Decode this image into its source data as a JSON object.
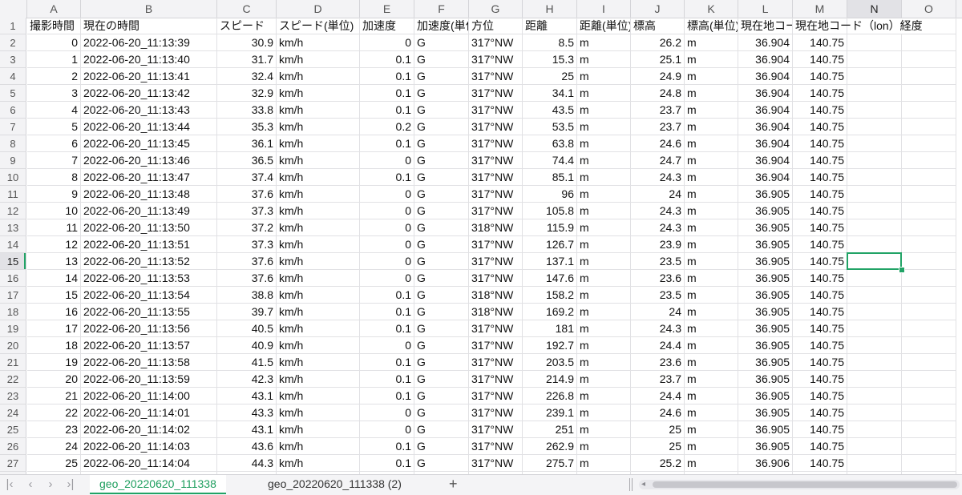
{
  "columns": [
    "A",
    "B",
    "C",
    "D",
    "E",
    "F",
    "G",
    "H",
    "I",
    "J",
    "K",
    "L",
    "M",
    "N",
    "O"
  ],
  "selected_column": "N",
  "selected_row": 15,
  "header_row": {
    "A": "撮影時間",
    "B": "現在の時間",
    "C": "スピード",
    "D": "スピード(単位)",
    "E": "加速度",
    "F": "加速度(単位)",
    "G": "方位",
    "H": "距離",
    "I": "距離(単位)",
    "J": "標高",
    "K": "標高(単位)",
    "L": "現在地コード（lat）",
    "M": "現在地コード（lon）経度"
  },
  "rows": [
    [
      "0",
      "2022-06-20_11:13:39",
      "30.9",
      "km/h",
      "0",
      "G",
      "317°NW",
      "8.5",
      "m",
      "26.2",
      "m",
      "36.904",
      "140.75"
    ],
    [
      "1",
      "2022-06-20_11:13:40",
      "31.7",
      "km/h",
      "0.1",
      "G",
      "317°NW",
      "15.3",
      "m",
      "25.1",
      "m",
      "36.904",
      "140.75"
    ],
    [
      "2",
      "2022-06-20_11:13:41",
      "32.4",
      "km/h",
      "0.1",
      "G",
      "317°NW",
      "25",
      "m",
      "24.9",
      "m",
      "36.904",
      "140.75"
    ],
    [
      "3",
      "2022-06-20_11:13:42",
      "32.9",
      "km/h",
      "0.1",
      "G",
      "317°NW",
      "34.1",
      "m",
      "24.8",
      "m",
      "36.904",
      "140.75"
    ],
    [
      "4",
      "2022-06-20_11:13:43",
      "33.8",
      "km/h",
      "0.1",
      "G",
      "317°NW",
      "43.5",
      "m",
      "23.7",
      "m",
      "36.904",
      "140.75"
    ],
    [
      "5",
      "2022-06-20_11:13:44",
      "35.3",
      "km/h",
      "0.2",
      "G",
      "317°NW",
      "53.5",
      "m",
      "23.7",
      "m",
      "36.904",
      "140.75"
    ],
    [
      "6",
      "2022-06-20_11:13:45",
      "36.1",
      "km/h",
      "0.1",
      "G",
      "317°NW",
      "63.8",
      "m",
      "24.6",
      "m",
      "36.904",
      "140.75"
    ],
    [
      "7",
      "2022-06-20_11:13:46",
      "36.5",
      "km/h",
      "0",
      "G",
      "317°NW",
      "74.4",
      "m",
      "24.7",
      "m",
      "36.904",
      "140.75"
    ],
    [
      "8",
      "2022-06-20_11:13:47",
      "37.4",
      "km/h",
      "0.1",
      "G",
      "317°NW",
      "85.1",
      "m",
      "24.3",
      "m",
      "36.904",
      "140.75"
    ],
    [
      "9",
      "2022-06-20_11:13:48",
      "37.6",
      "km/h",
      "0",
      "G",
      "317°NW",
      "96",
      "m",
      "24",
      "m",
      "36.905",
      "140.75"
    ],
    [
      "10",
      "2022-06-20_11:13:49",
      "37.3",
      "km/h",
      "0",
      "G",
      "317°NW",
      "105.8",
      "m",
      "24.3",
      "m",
      "36.905",
      "140.75"
    ],
    [
      "11",
      "2022-06-20_11:13:50",
      "37.2",
      "km/h",
      "0",
      "G",
      "318°NW",
      "115.9",
      "m",
      "24.3",
      "m",
      "36.905",
      "140.75"
    ],
    [
      "12",
      "2022-06-20_11:13:51",
      "37.3",
      "km/h",
      "0",
      "G",
      "317°NW",
      "126.7",
      "m",
      "23.9",
      "m",
      "36.905",
      "140.75"
    ],
    [
      "13",
      "2022-06-20_11:13:52",
      "37.6",
      "km/h",
      "0",
      "G",
      "317°NW",
      "137.1",
      "m",
      "23.5",
      "m",
      "36.905",
      "140.75"
    ],
    [
      "14",
      "2022-06-20_11:13:53",
      "37.6",
      "km/h",
      "0",
      "G",
      "317°NW",
      "147.6",
      "m",
      "23.6",
      "m",
      "36.905",
      "140.75"
    ],
    [
      "15",
      "2022-06-20_11:13:54",
      "38.8",
      "km/h",
      "0.1",
      "G",
      "318°NW",
      "158.2",
      "m",
      "23.5",
      "m",
      "36.905",
      "140.75"
    ],
    [
      "16",
      "2022-06-20_11:13:55",
      "39.7",
      "km/h",
      "0.1",
      "G",
      "318°NW",
      "169.2",
      "m",
      "24",
      "m",
      "36.905",
      "140.75"
    ],
    [
      "17",
      "2022-06-20_11:13:56",
      "40.5",
      "km/h",
      "0.1",
      "G",
      "317°NW",
      "181",
      "m",
      "24.3",
      "m",
      "36.905",
      "140.75"
    ],
    [
      "18",
      "2022-06-20_11:13:57",
      "40.9",
      "km/h",
      "0",
      "G",
      "317°NW",
      "192.7",
      "m",
      "24.4",
      "m",
      "36.905",
      "140.75"
    ],
    [
      "19",
      "2022-06-20_11:13:58",
      "41.5",
      "km/h",
      "0.1",
      "G",
      "317°NW",
      "203.5",
      "m",
      "23.6",
      "m",
      "36.905",
      "140.75"
    ],
    [
      "20",
      "2022-06-20_11:13:59",
      "42.3",
      "km/h",
      "0.1",
      "G",
      "317°NW",
      "214.9",
      "m",
      "23.7",
      "m",
      "36.905",
      "140.75"
    ],
    [
      "21",
      "2022-06-20_11:14:00",
      "43.1",
      "km/h",
      "0.1",
      "G",
      "317°NW",
      "226.8",
      "m",
      "24.4",
      "m",
      "36.905",
      "140.75"
    ],
    [
      "22",
      "2022-06-20_11:14:01",
      "43.3",
      "km/h",
      "0",
      "G",
      "317°NW",
      "239.1",
      "m",
      "24.6",
      "m",
      "36.905",
      "140.75"
    ],
    [
      "23",
      "2022-06-20_11:14:02",
      "43.1",
      "km/h",
      "0",
      "G",
      "317°NW",
      "251",
      "m",
      "25",
      "m",
      "36.905",
      "140.75"
    ],
    [
      "24",
      "2022-06-20_11:14:03",
      "43.6",
      "km/h",
      "0.1",
      "G",
      "317°NW",
      "262.9",
      "m",
      "25",
      "m",
      "36.905",
      "140.75"
    ],
    [
      "25",
      "2022-06-20_11:14:04",
      "44.3",
      "km/h",
      "0.1",
      "G",
      "317°NW",
      "275.7",
      "m",
      "25.2",
      "m",
      "36.906",
      "140.75"
    ]
  ],
  "tabs": {
    "nav_first": "|‹",
    "nav_prev": "‹",
    "nav_next": "›",
    "nav_last": "›|",
    "items": [
      "geo_20220620_111338",
      "geo_20220620_111338 (2)"
    ],
    "active_index": 0,
    "add": "+"
  },
  "colors": {
    "accent": "#21a366",
    "header_bg": "#f3f3f5",
    "grid": "#e1e1e4"
  }
}
